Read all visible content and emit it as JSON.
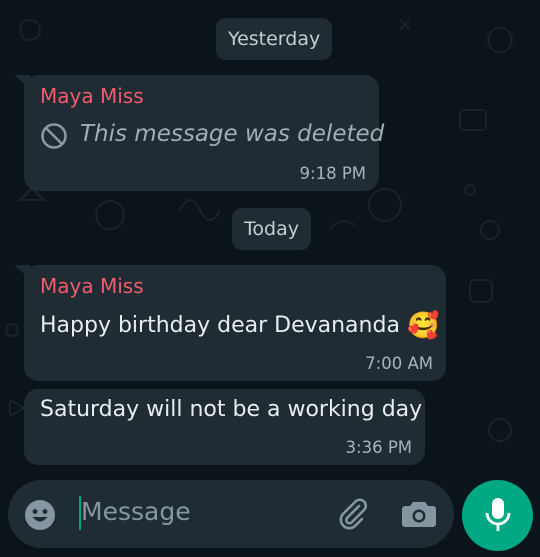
{
  "chat": {
    "date_yesterday": "Yesterday",
    "date_today": "Today",
    "messages": [
      {
        "sender": "Maya Miss",
        "deleted_text": "This message was deleted",
        "time": "9:18 PM"
      },
      {
        "sender": "Maya Miss",
        "text": "Happy birthday dear Devananda",
        "emoji": "🥰",
        "time": "7:00 AM"
      },
      {
        "text": "Saturday will not be a working day",
        "time": "3:36 PM"
      }
    ]
  },
  "composer": {
    "placeholder": "Message",
    "icons": [
      "emoji-icon",
      "paperclip-icon",
      "camera-icon",
      "mic-icon"
    ]
  },
  "colors": {
    "background": "#0b141a",
    "bubble": "#1f2c34",
    "sender_name": "#f15c6d",
    "accent": "#00a884"
  }
}
